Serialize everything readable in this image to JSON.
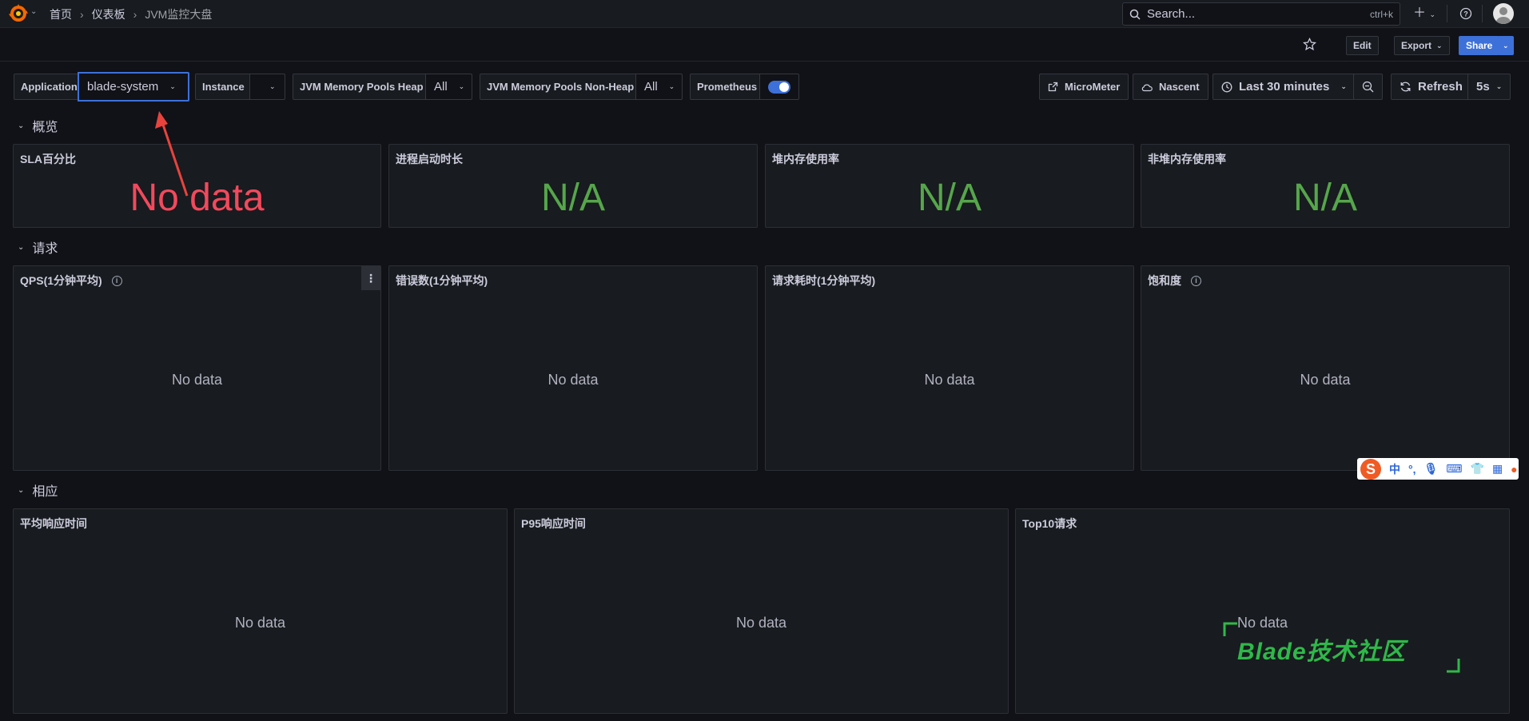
{
  "breadcrumb": [
    "首页",
    "仪表板",
    "JVM监控大盘"
  ],
  "search": {
    "placeholder": "Search...",
    "shortcut": "ctrl+k"
  },
  "toolbar": {
    "edit": "Edit",
    "export": "Export",
    "share": "Share"
  },
  "variables": {
    "application": {
      "label": "Application",
      "value": "blade-system"
    },
    "instance": {
      "label": "Instance",
      "value": ""
    },
    "heap": {
      "label": "JVM Memory Pools Heap",
      "value": "All"
    },
    "nonheap": {
      "label": "JVM Memory Pools Non-Heap",
      "value": "All"
    },
    "prometheus": {
      "label": "Prometheus",
      "enabled": true
    }
  },
  "links": {
    "micrometer": "MicroMeter",
    "nascent": "Nascent"
  },
  "time": {
    "range": "Last 30 minutes",
    "refresh": "Refresh",
    "interval": "5s"
  },
  "rows": {
    "overview": "概览",
    "requests": "请求",
    "response": "相应"
  },
  "overview_panels": [
    {
      "title": "SLA百分比",
      "value": "No data",
      "color": "#f2495c"
    },
    {
      "title": "进程启动时长",
      "value": "N/A",
      "color": "#56a64b"
    },
    {
      "title": "堆内存使用率",
      "value": "N/A",
      "color": "#56a64b"
    },
    {
      "title": "非堆内存使用率",
      "value": "N/A",
      "color": "#56a64b"
    }
  ],
  "request_panels": [
    {
      "title": "QPS(1分钟平均)",
      "message": "No data",
      "info": true
    },
    {
      "title": "错误数(1分钟平均)",
      "message": "No data",
      "info": false
    },
    {
      "title": "请求耗时(1分钟平均)",
      "message": "No data",
      "info": false
    },
    {
      "title": "饱和度",
      "message": "No data",
      "info": true
    }
  ],
  "response_panels": [
    {
      "title": "平均响应时间",
      "message": "No data"
    },
    {
      "title": "P95响应时间",
      "message": "No data"
    },
    {
      "title": "Top10请求",
      "message": "No data"
    }
  ],
  "ime": {
    "mode": "中"
  },
  "watermark": "Blade技术社区"
}
